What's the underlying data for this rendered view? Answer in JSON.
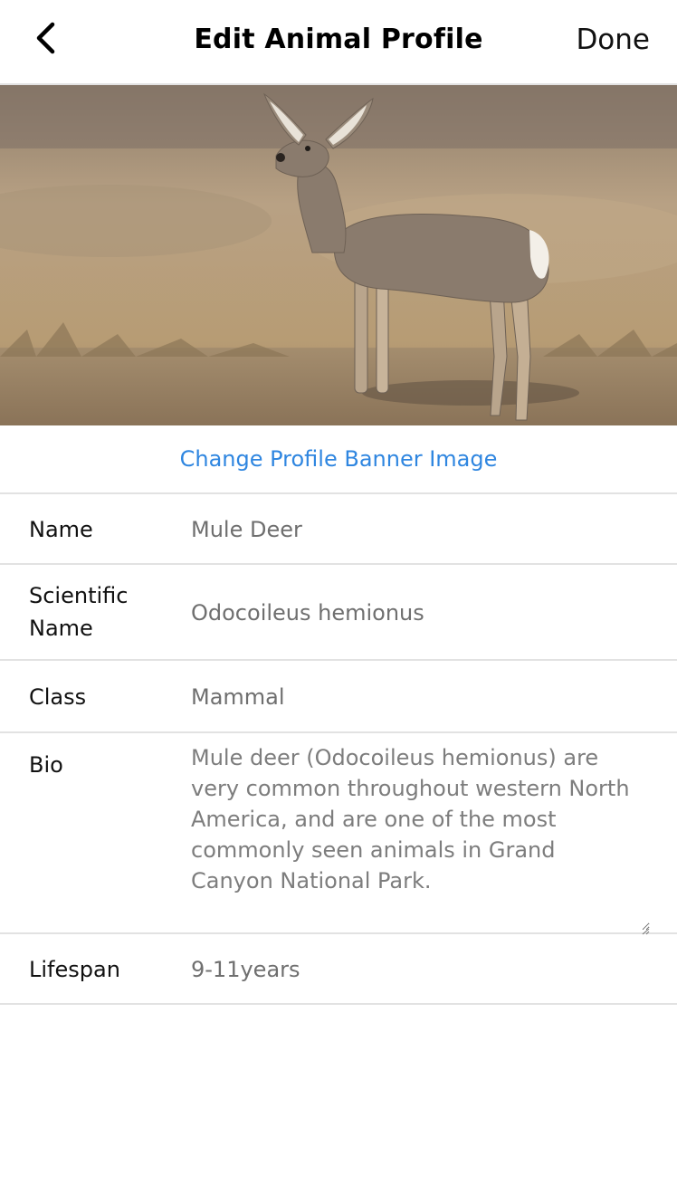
{
  "header": {
    "title": "Edit Animal Profile",
    "done_label": "Done",
    "back_icon": "chevron-left-icon"
  },
  "banner": {
    "change_link_label": "Change Profile Banner Image",
    "link_color": "#2f86e0"
  },
  "fields": {
    "name": {
      "label": "Name",
      "value": "Mule Deer"
    },
    "scientific_name": {
      "label_line1": "Scientific",
      "label_line2": "Name",
      "value": "Odocoileus hemionus"
    },
    "class": {
      "label": "Class",
      "value": "Mammal"
    },
    "bio": {
      "label": "Bio",
      "value": "Mule deer (Odocoileus hemionus) are very common throughout western North America, and are one of the most commonly seen animals in Grand Canyon National Park."
    },
    "lifespan": {
      "label": "Lifespan",
      "value": "9-11years"
    }
  }
}
